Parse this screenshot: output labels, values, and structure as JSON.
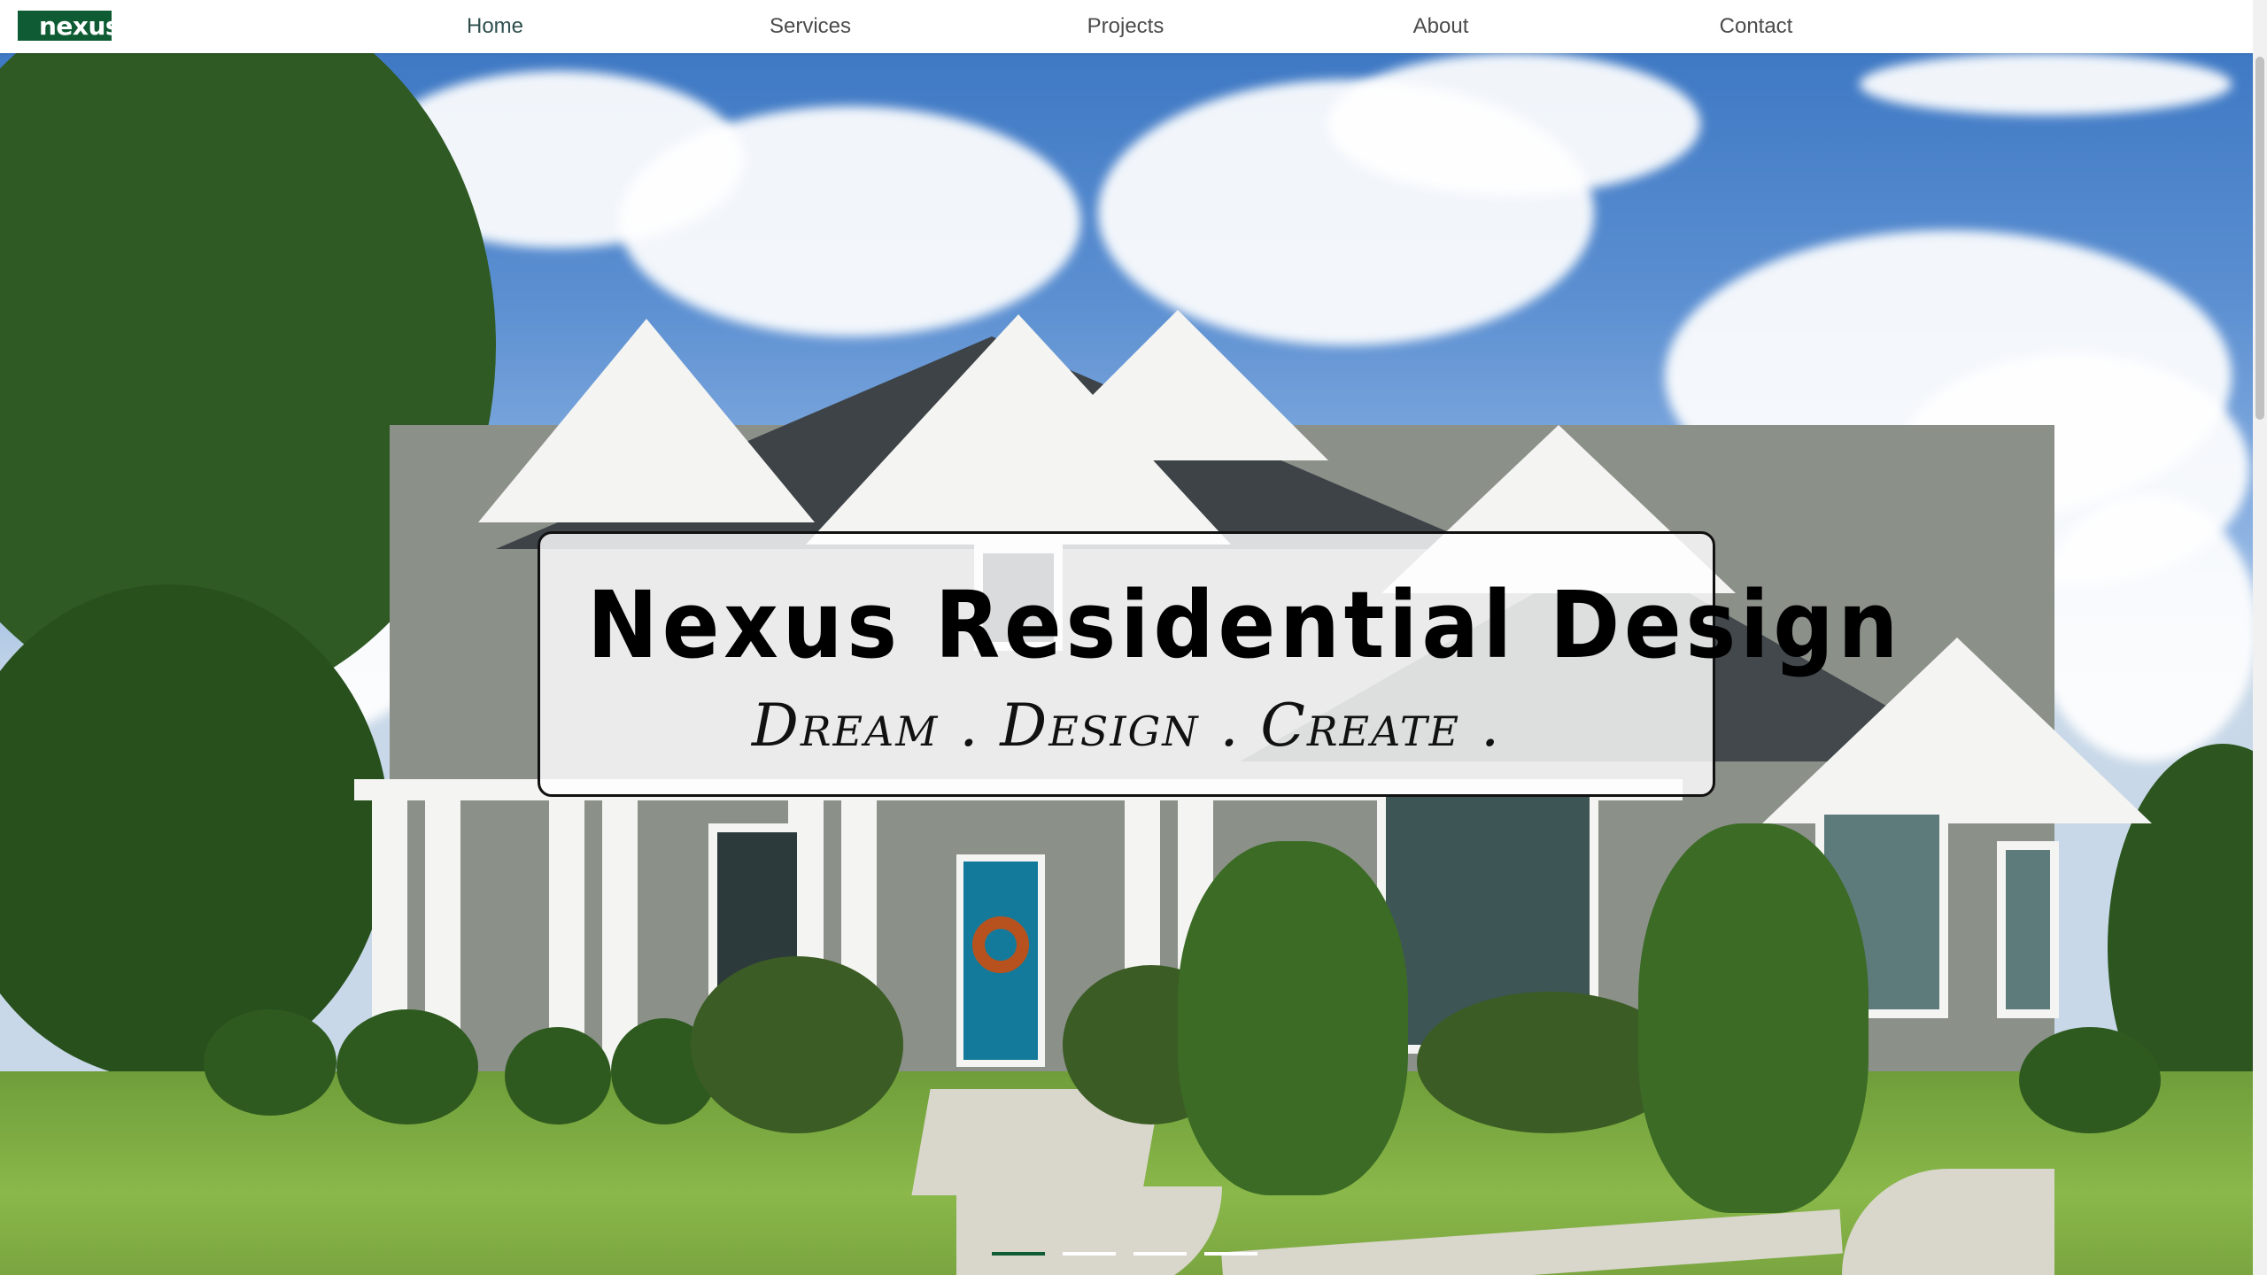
{
  "nav": {
    "logo_text": "nexus.",
    "links": [
      {
        "label": "Home",
        "active": true
      },
      {
        "label": "Services",
        "active": false
      },
      {
        "label": "Projects",
        "active": false
      },
      {
        "label": "About",
        "active": false
      },
      {
        "label": "Contact",
        "active": false
      }
    ]
  },
  "hero": {
    "image_icon": "house-photo",
    "title": "Nexus Residential Design",
    "tagline": "Dream . Design . Create ."
  },
  "carousel": {
    "slide_count": 4,
    "active_index": 0
  },
  "colors": {
    "brand": "#0f5c34",
    "nav_text": "#4b4b4b",
    "indicator_inactive": "#ffffff",
    "card_border": "#111111"
  }
}
